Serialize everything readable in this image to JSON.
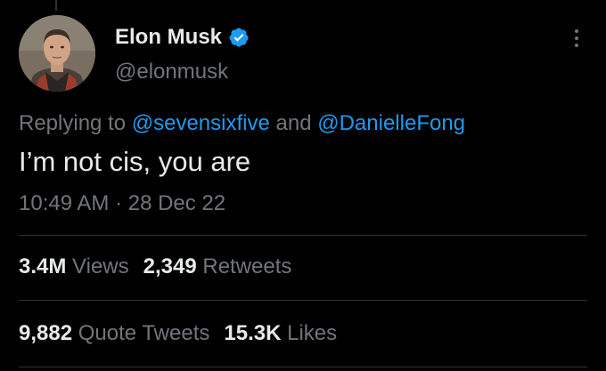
{
  "author": {
    "name": "Elon Musk",
    "handle": "@elonmusk",
    "verified": true,
    "verified_color": "#1d9bf0"
  },
  "reply": {
    "prefix": "Replying to",
    "mentions": [
      "@sevensixfive",
      "@DanielleFong"
    ],
    "joiner": "and"
  },
  "tweet": {
    "text": "I’m not cis, you are",
    "timestamp": "10:49 AM · 28 Dec 22"
  },
  "stats": {
    "row1": [
      {
        "count": "3.4M",
        "label": "Views"
      },
      {
        "count": "2,349",
        "label": "Retweets"
      }
    ],
    "row2": [
      {
        "count": "9,882",
        "label": "Quote Tweets"
      },
      {
        "count": "15.3K",
        "label": "Likes"
      }
    ]
  },
  "icons": {
    "verified": "verified-badge-icon",
    "more": "more-options-icon"
  },
  "colors": {
    "background": "#000000",
    "primary_text": "#e7e9ea",
    "secondary_text": "#71767b",
    "link": "#1d9bf0",
    "divider": "#2f3336"
  }
}
